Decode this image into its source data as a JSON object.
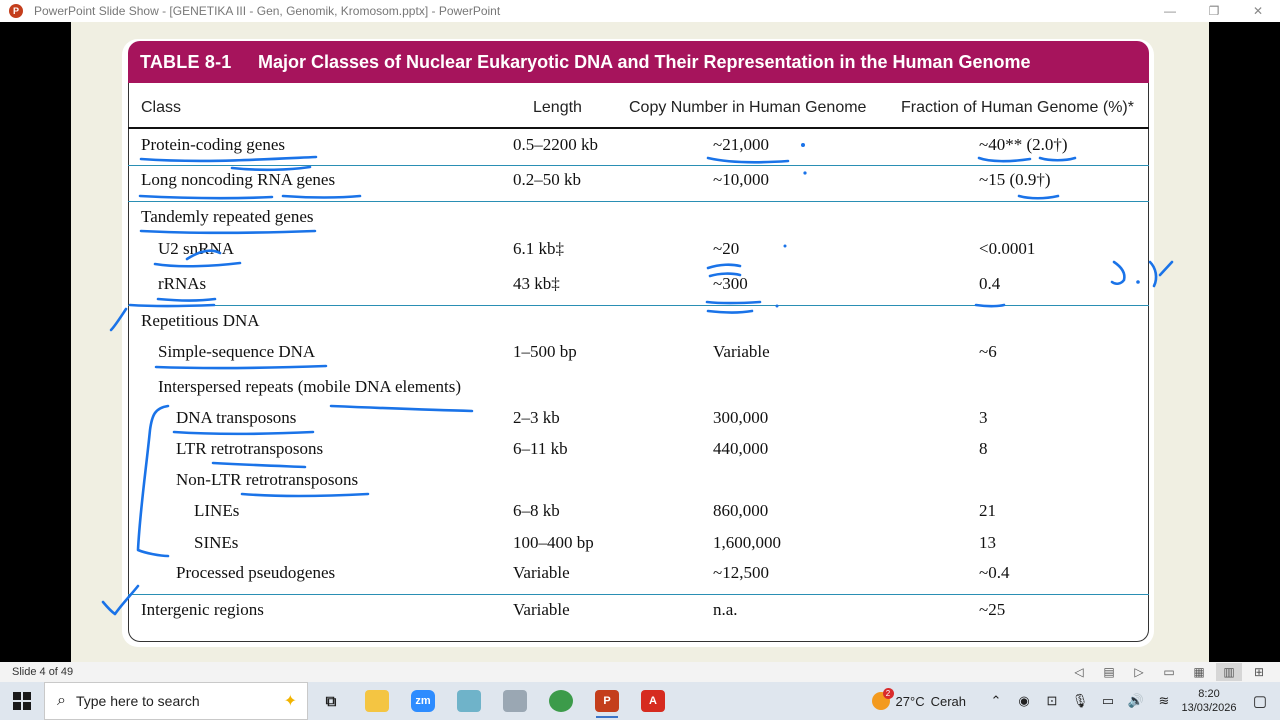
{
  "window": {
    "title": "PowerPoint Slide Show - [GENETIKA III - Gen, Genomik, Kromosom.pptx] - PowerPoint",
    "app_icon": "P",
    "minimize": "—",
    "restore": "❐",
    "close": "✕"
  },
  "table": {
    "number": "TABLE 8-1",
    "caption": "Major Classes of Nuclear Eukaryotic DNA and Their Representation in the Human Genome",
    "headers": {
      "class": "Class",
      "length": "Length",
      "copy": "Copy Number in Human Genome",
      "fraction": "Fraction of Human Genome (%)*"
    },
    "rows": [
      {
        "cls": "Protein-coding genes",
        "len": "0.5–2200 kb",
        "copy": "~21,000",
        "frac": "~40** (2.0†)"
      },
      {
        "cls": "Long noncoding RNA genes",
        "len": "0.2–50 kb",
        "copy": "~10,000",
        "frac": "~15 (0.9†)"
      },
      {
        "cls": "Tandemly repeated genes",
        "len": "",
        "copy": "",
        "frac": ""
      },
      {
        "cls": "U2 snRNA",
        "len": "6.1 kb‡",
        "copy": "~20",
        "frac": "<0.0001"
      },
      {
        "cls": "rRNAs",
        "len": "43 kb‡",
        "copy": "~300",
        "frac": "0.4"
      },
      {
        "cls": "Repetitious DNA",
        "len": "",
        "copy": "",
        "frac": ""
      },
      {
        "cls": "Simple-sequence DNA",
        "len": "1–500 bp",
        "copy": "Variable",
        "frac": "~6"
      },
      {
        "cls": "Interspersed repeats (mobile DNA elements)",
        "len": "",
        "copy": "",
        "frac": ""
      },
      {
        "cls": "DNA transposons",
        "len": "2–3 kb",
        "copy": "300,000",
        "frac": "3"
      },
      {
        "cls": "LTR retrotransposons",
        "len": "6–11 kb",
        "copy": "440,000",
        "frac": "8"
      },
      {
        "cls": "Non-LTR retrotransposons",
        "len": "",
        "copy": "",
        "frac": ""
      },
      {
        "cls": "LINEs",
        "len": "6–8 kb",
        "copy": "860,000",
        "frac": "21"
      },
      {
        "cls": "SINEs",
        "len": "100–400 bp",
        "copy": "1,600,000",
        "frac": "13"
      },
      {
        "cls": "Processed pseudogenes",
        "len": "Variable",
        "copy": "~12,500",
        "frac": "~0.4"
      },
      {
        "cls": "Intergenic regions",
        "len": "Variable",
        "copy": "n.a.",
        "frac": "~25"
      }
    ]
  },
  "status": {
    "slide_info": "Slide 4 of 49"
  },
  "taskbar": {
    "search_placeholder": "Type here to search",
    "weather_temp": "27°C",
    "weather_text": "Cerah",
    "weather_badge": "2",
    "time": "8:20",
    "date": "13/03/2026"
  },
  "colors": {
    "header_bg": "#a6145c",
    "ink": "#1a73e8",
    "rule": "#2a8fb4",
    "slide_bg": "#f0efe2"
  }
}
